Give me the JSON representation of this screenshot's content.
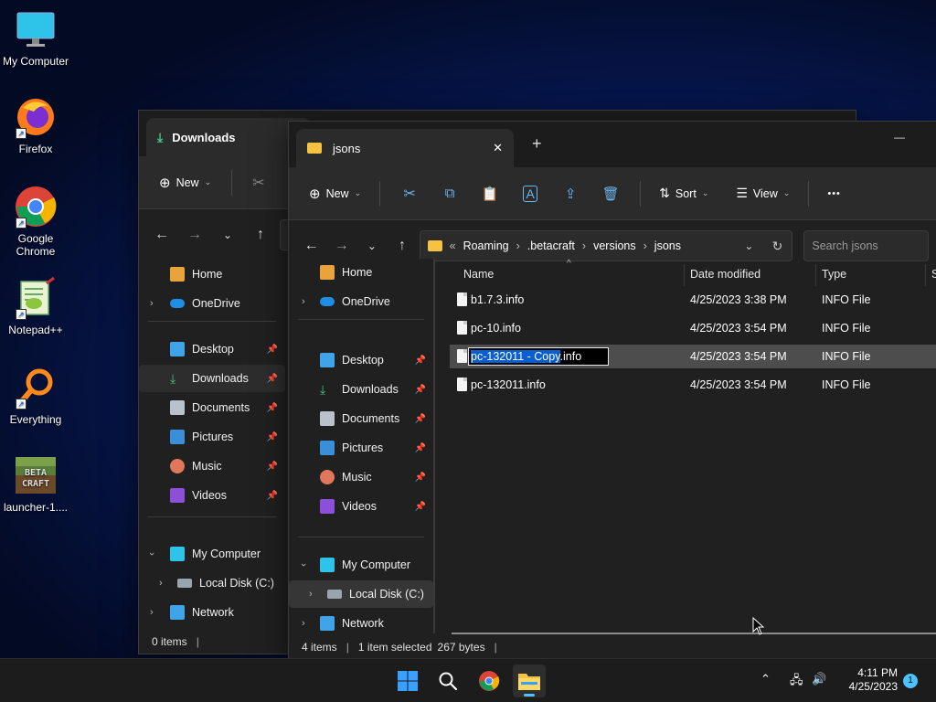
{
  "desktop": {
    "icons": [
      {
        "label": "My Computer",
        "icon": "monitor-icon"
      },
      {
        "label": "Firefox",
        "icon": "firefox-icon"
      },
      {
        "label": "Google Chrome",
        "icon": "chrome-icon"
      },
      {
        "label": "Notepad++",
        "icon": "notepad-plus-plus-icon"
      },
      {
        "label": "Everything",
        "icon": "everything-search-icon"
      },
      {
        "label": "launcher-1....",
        "icon": "betacraft-icon"
      }
    ]
  },
  "back_window": {
    "tab_title": "Downloads",
    "toolbar": {
      "new_label": "New"
    },
    "sidebar": {
      "home": "Home",
      "onedrive": "OneDrive",
      "quick": [
        "Desktop",
        "Downloads",
        "Documents",
        "Pictures",
        "Music",
        "Videos"
      ],
      "my_computer": "My Computer",
      "local_disk": "Local Disk (C:)",
      "network": "Network"
    },
    "status": {
      "items": "0 items"
    }
  },
  "front_window": {
    "tab_title": "jsons",
    "new_tab_symbol": "+",
    "close_tab_symbol": "✕",
    "minimize_symbol": "—",
    "toolbar": {
      "new_label": "New",
      "sort_label": "Sort",
      "view_label": "View",
      "more_label": "•••"
    },
    "address": {
      "overflow": "«",
      "crumbs": [
        "Roaming",
        ".betacraft",
        "versions",
        "jsons"
      ],
      "separator": "›",
      "search_placeholder": "Search jsons"
    },
    "sidebar": {
      "home": "Home",
      "onedrive": "OneDrive",
      "quick": [
        "Desktop",
        "Downloads",
        "Documents",
        "Pictures",
        "Music",
        "Videos"
      ],
      "my_computer": "My Computer",
      "local_disk": "Local Disk (C:)",
      "network": "Network"
    },
    "columns": {
      "name": "Name",
      "date": "Date modified",
      "type": "Type",
      "size": "S"
    },
    "files": [
      {
        "name": "b1.7.3.info",
        "date": "4/25/2023 3:38 PM",
        "type": "INFO File"
      },
      {
        "name": "pc-10.info",
        "date": "4/25/2023 3:54 PM",
        "type": "INFO File"
      },
      {
        "name": "pc-132011 - Copy.info",
        "date": "4/25/2023 3:54 PM",
        "type": "INFO File",
        "rename_selected": "pc-132011 - Copy",
        "rename_rest": ".info"
      },
      {
        "name": "pc-132011.info",
        "date": "4/25/2023 3:54 PM",
        "type": "INFO File"
      }
    ],
    "status": {
      "items": "4 items",
      "selected": "1 item selected",
      "size": "267 bytes"
    }
  },
  "taskbar": {
    "time": "4:11 PM",
    "date": "4/25/2023",
    "notification_count": "1"
  },
  "colors": {
    "accent": "#4cc2ff",
    "selection": "#0a5fd0",
    "folder": "#f5c242"
  }
}
